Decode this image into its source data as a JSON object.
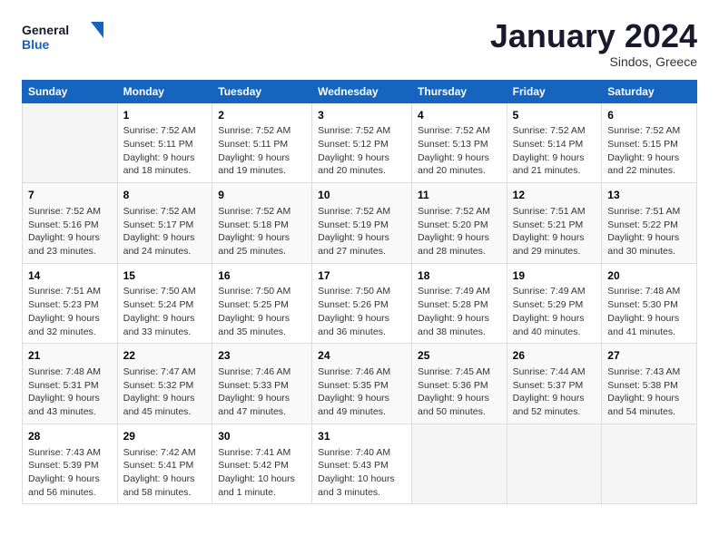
{
  "logo": {
    "line1": "General",
    "line2": "Blue"
  },
  "title": "January 2024",
  "subtitle": "Sindos, Greece",
  "days_header": [
    "Sunday",
    "Monday",
    "Tuesday",
    "Wednesday",
    "Thursday",
    "Friday",
    "Saturday"
  ],
  "weeks": [
    [
      {
        "num": "",
        "info": ""
      },
      {
        "num": "1",
        "info": "Sunrise: 7:52 AM\nSunset: 5:11 PM\nDaylight: 9 hours\nand 18 minutes."
      },
      {
        "num": "2",
        "info": "Sunrise: 7:52 AM\nSunset: 5:11 PM\nDaylight: 9 hours\nand 19 minutes."
      },
      {
        "num": "3",
        "info": "Sunrise: 7:52 AM\nSunset: 5:12 PM\nDaylight: 9 hours\nand 20 minutes."
      },
      {
        "num": "4",
        "info": "Sunrise: 7:52 AM\nSunset: 5:13 PM\nDaylight: 9 hours\nand 20 minutes."
      },
      {
        "num": "5",
        "info": "Sunrise: 7:52 AM\nSunset: 5:14 PM\nDaylight: 9 hours\nand 21 minutes."
      },
      {
        "num": "6",
        "info": "Sunrise: 7:52 AM\nSunset: 5:15 PM\nDaylight: 9 hours\nand 22 minutes."
      }
    ],
    [
      {
        "num": "7",
        "info": "Sunrise: 7:52 AM\nSunset: 5:16 PM\nDaylight: 9 hours\nand 23 minutes."
      },
      {
        "num": "8",
        "info": "Sunrise: 7:52 AM\nSunset: 5:17 PM\nDaylight: 9 hours\nand 24 minutes."
      },
      {
        "num": "9",
        "info": "Sunrise: 7:52 AM\nSunset: 5:18 PM\nDaylight: 9 hours\nand 25 minutes."
      },
      {
        "num": "10",
        "info": "Sunrise: 7:52 AM\nSunset: 5:19 PM\nDaylight: 9 hours\nand 27 minutes."
      },
      {
        "num": "11",
        "info": "Sunrise: 7:52 AM\nSunset: 5:20 PM\nDaylight: 9 hours\nand 28 minutes."
      },
      {
        "num": "12",
        "info": "Sunrise: 7:51 AM\nSunset: 5:21 PM\nDaylight: 9 hours\nand 29 minutes."
      },
      {
        "num": "13",
        "info": "Sunrise: 7:51 AM\nSunset: 5:22 PM\nDaylight: 9 hours\nand 30 minutes."
      }
    ],
    [
      {
        "num": "14",
        "info": "Sunrise: 7:51 AM\nSunset: 5:23 PM\nDaylight: 9 hours\nand 32 minutes."
      },
      {
        "num": "15",
        "info": "Sunrise: 7:50 AM\nSunset: 5:24 PM\nDaylight: 9 hours\nand 33 minutes."
      },
      {
        "num": "16",
        "info": "Sunrise: 7:50 AM\nSunset: 5:25 PM\nDaylight: 9 hours\nand 35 minutes."
      },
      {
        "num": "17",
        "info": "Sunrise: 7:50 AM\nSunset: 5:26 PM\nDaylight: 9 hours\nand 36 minutes."
      },
      {
        "num": "18",
        "info": "Sunrise: 7:49 AM\nSunset: 5:28 PM\nDaylight: 9 hours\nand 38 minutes."
      },
      {
        "num": "19",
        "info": "Sunrise: 7:49 AM\nSunset: 5:29 PM\nDaylight: 9 hours\nand 40 minutes."
      },
      {
        "num": "20",
        "info": "Sunrise: 7:48 AM\nSunset: 5:30 PM\nDaylight: 9 hours\nand 41 minutes."
      }
    ],
    [
      {
        "num": "21",
        "info": "Sunrise: 7:48 AM\nSunset: 5:31 PM\nDaylight: 9 hours\nand 43 minutes."
      },
      {
        "num": "22",
        "info": "Sunrise: 7:47 AM\nSunset: 5:32 PM\nDaylight: 9 hours\nand 45 minutes."
      },
      {
        "num": "23",
        "info": "Sunrise: 7:46 AM\nSunset: 5:33 PM\nDaylight: 9 hours\nand 47 minutes."
      },
      {
        "num": "24",
        "info": "Sunrise: 7:46 AM\nSunset: 5:35 PM\nDaylight: 9 hours\nand 49 minutes."
      },
      {
        "num": "25",
        "info": "Sunrise: 7:45 AM\nSunset: 5:36 PM\nDaylight: 9 hours\nand 50 minutes."
      },
      {
        "num": "26",
        "info": "Sunrise: 7:44 AM\nSunset: 5:37 PM\nDaylight: 9 hours\nand 52 minutes."
      },
      {
        "num": "27",
        "info": "Sunrise: 7:43 AM\nSunset: 5:38 PM\nDaylight: 9 hours\nand 54 minutes."
      }
    ],
    [
      {
        "num": "28",
        "info": "Sunrise: 7:43 AM\nSunset: 5:39 PM\nDaylight: 9 hours\nand 56 minutes."
      },
      {
        "num": "29",
        "info": "Sunrise: 7:42 AM\nSunset: 5:41 PM\nDaylight: 9 hours\nand 58 minutes."
      },
      {
        "num": "30",
        "info": "Sunrise: 7:41 AM\nSunset: 5:42 PM\nDaylight: 10 hours\nand 1 minute."
      },
      {
        "num": "31",
        "info": "Sunrise: 7:40 AM\nSunset: 5:43 PM\nDaylight: 10 hours\nand 3 minutes."
      },
      {
        "num": "",
        "info": ""
      },
      {
        "num": "",
        "info": ""
      },
      {
        "num": "",
        "info": ""
      }
    ]
  ]
}
